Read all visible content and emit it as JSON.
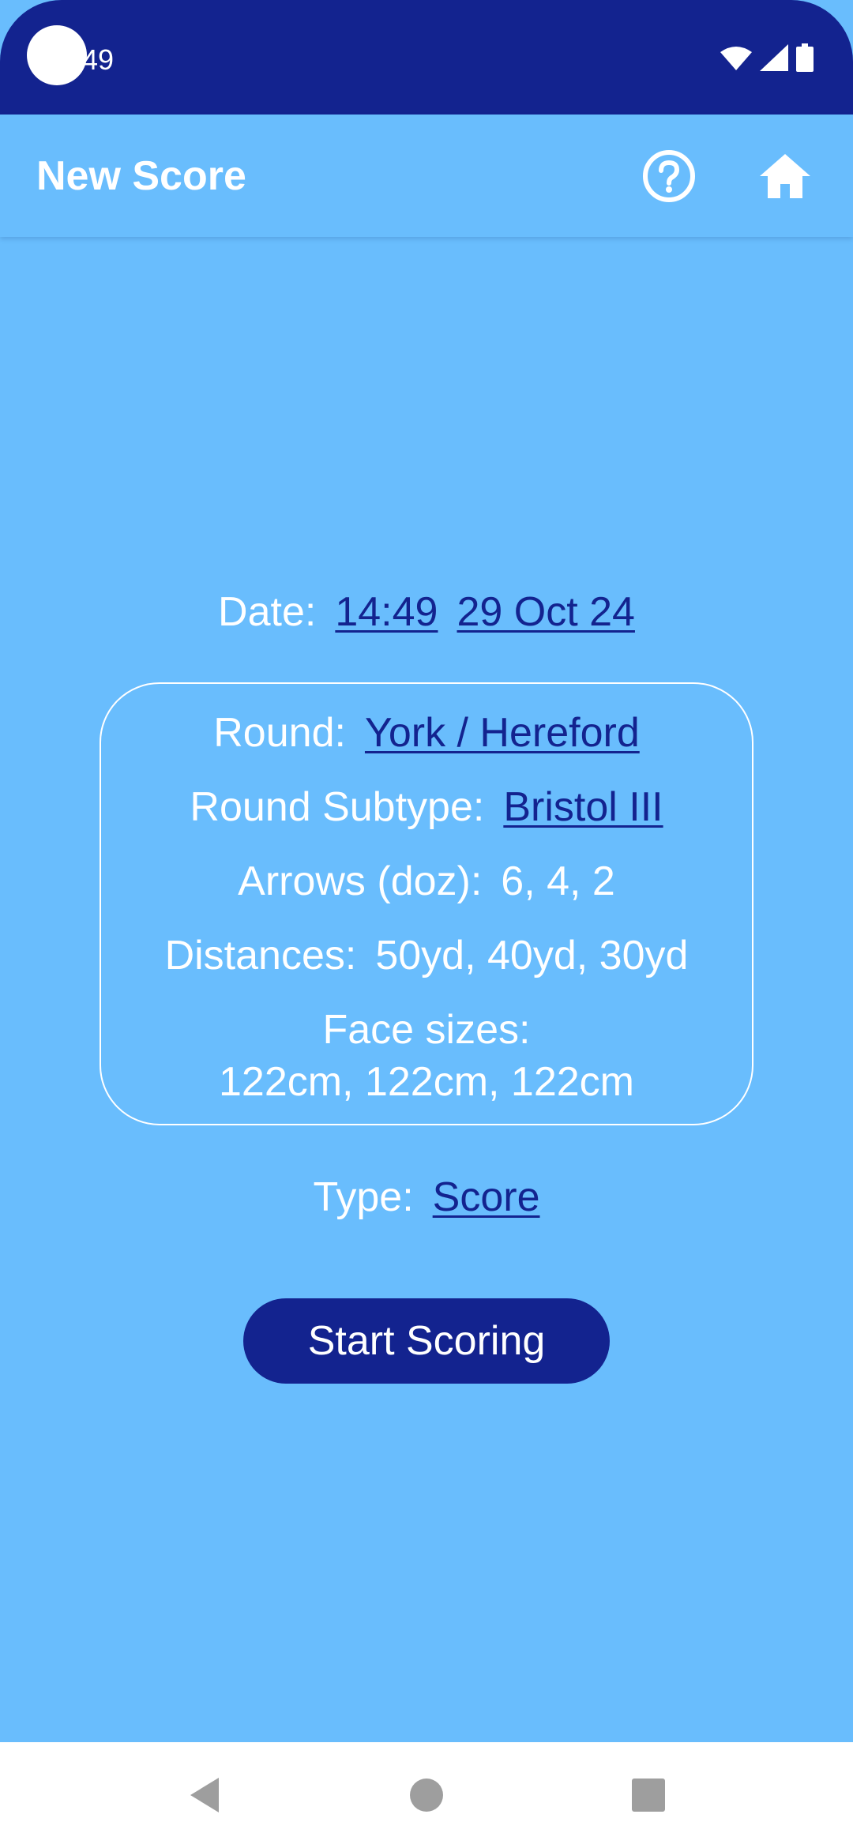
{
  "status_bar": {
    "time": "49",
    "icons": [
      "wifi-icon",
      "signal-icon",
      "battery-icon"
    ]
  },
  "app_bar": {
    "title": "New Score",
    "actions": [
      "help-icon",
      "home-icon"
    ]
  },
  "date": {
    "label": "Date:",
    "time": "14:49",
    "day": "29 Oct 24"
  },
  "round_info": {
    "round_label": "Round:",
    "round_value": "York / Hereford",
    "subtype_label": "Round Subtype:",
    "subtype_value": "Bristol III",
    "arrows_label": "Arrows (doz):",
    "arrows_value": "6, 4, 2",
    "distances_label": "Distances:",
    "distances_value": "50yd, 40yd, 30yd",
    "face_sizes_label": "Face sizes:",
    "face_sizes_value": "122cm, 122cm, 122cm"
  },
  "type": {
    "label": "Type:",
    "value": "Score"
  },
  "start_button": {
    "label": "Start Scoring"
  },
  "nav_bar": {
    "icons": [
      "back-icon",
      "home-circle-icon",
      "recents-icon"
    ]
  },
  "colors": {
    "background": "#69bdfd",
    "primary_dark": "#13238f",
    "text": "#ffffff",
    "nav_background": "#ffffff",
    "nav_icons": "#9e9e9e"
  }
}
